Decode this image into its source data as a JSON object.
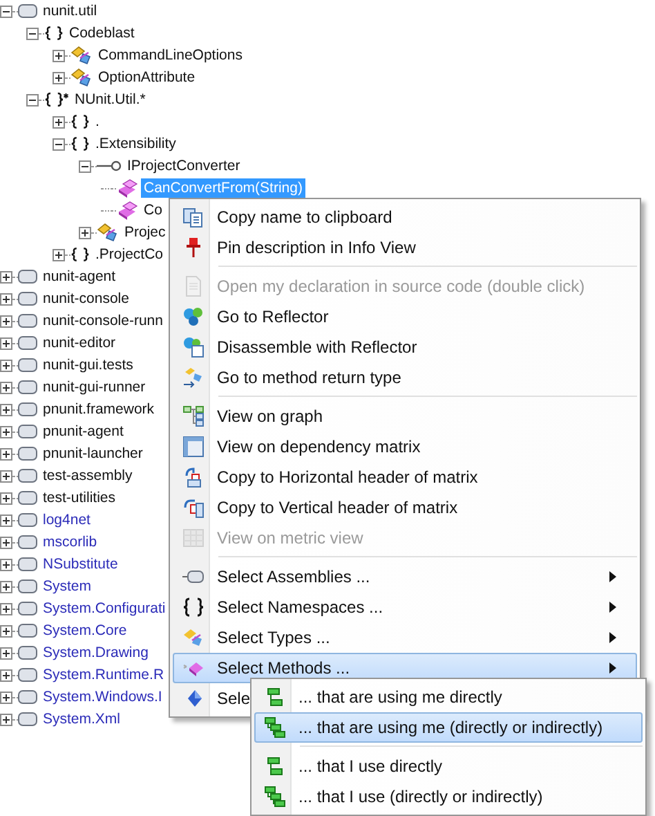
{
  "tree": [
    {
      "kind": "assembly",
      "label": "nunit.util",
      "external": false,
      "expanded": true,
      "selected": false,
      "children": [
        {
          "kind": "namespace",
          "label": "Codeblast",
          "expanded": true,
          "selected": false,
          "children": [
            {
              "kind": "class",
              "label": "CommandLineOptions",
              "expanded": false,
              "selected": false
            },
            {
              "kind": "class",
              "label": "OptionAttribute",
              "expanded": false,
              "selected": false
            }
          ]
        },
        {
          "kind": "namespace-group",
          "label": "NUnit.Util.*",
          "expanded": true,
          "selected": false,
          "children": [
            {
              "kind": "namespace",
              "label": ".",
              "expanded": false,
              "selected": false
            },
            {
              "kind": "namespace",
              "label": ".Extensibility",
              "expanded": true,
              "selected": false,
              "children": [
                {
                  "kind": "interface",
                  "label": "IProjectConverter",
                  "expanded": true,
                  "selected": false,
                  "children": [
                    {
                      "kind": "method",
                      "label": "CanConvertFrom(String)",
                      "selected": true
                    },
                    {
                      "kind": "method",
                      "label": "Co",
                      "selected": false
                    }
                  ]
                },
                {
                  "kind": "class",
                  "label": "Projec",
                  "expanded": false,
                  "selected": false
                }
              ]
            },
            {
              "kind": "namespace",
              "label": ".ProjectCo",
              "expanded": false,
              "selected": false
            }
          ]
        }
      ]
    },
    {
      "kind": "assembly",
      "label": "nunit-agent",
      "external": false,
      "expanded": false,
      "selected": false
    },
    {
      "kind": "assembly",
      "label": "nunit-console",
      "external": false,
      "expanded": false,
      "selected": false
    },
    {
      "kind": "assembly",
      "label": "nunit-console-runn",
      "external": false,
      "expanded": false,
      "selected": false
    },
    {
      "kind": "assembly",
      "label": "nunit-editor",
      "external": false,
      "expanded": false,
      "selected": false
    },
    {
      "kind": "assembly",
      "label": "nunit-gui.tests",
      "external": false,
      "expanded": false,
      "selected": false
    },
    {
      "kind": "assembly",
      "label": "nunit-gui-runner",
      "external": false,
      "expanded": false,
      "selected": false
    },
    {
      "kind": "assembly",
      "label": "pnunit.framework",
      "external": false,
      "expanded": false,
      "selected": false
    },
    {
      "kind": "assembly",
      "label": "pnunit-agent",
      "external": false,
      "expanded": false,
      "selected": false
    },
    {
      "kind": "assembly",
      "label": "pnunit-launcher",
      "external": false,
      "expanded": false,
      "selected": false
    },
    {
      "kind": "assembly",
      "label": "test-assembly",
      "external": false,
      "expanded": false,
      "selected": false
    },
    {
      "kind": "assembly",
      "label": "test-utilities",
      "external": false,
      "expanded": false,
      "selected": false
    },
    {
      "kind": "assembly",
      "label": "log4net",
      "external": true,
      "expanded": false,
      "selected": false
    },
    {
      "kind": "assembly",
      "label": "mscorlib",
      "external": true,
      "expanded": false,
      "selected": false
    },
    {
      "kind": "assembly",
      "label": "NSubstitute",
      "external": true,
      "expanded": false,
      "selected": false
    },
    {
      "kind": "assembly",
      "label": "System",
      "external": true,
      "expanded": false,
      "selected": false
    },
    {
      "kind": "assembly",
      "label": "System.Configurati",
      "external": true,
      "expanded": false,
      "selected": false
    },
    {
      "kind": "assembly",
      "label": "System.Core",
      "external": true,
      "expanded": false,
      "selected": false
    },
    {
      "kind": "assembly",
      "label": "System.Drawing",
      "external": true,
      "expanded": false,
      "selected": false
    },
    {
      "kind": "assembly",
      "label": "System.Runtime.R",
      "external": true,
      "expanded": false,
      "selected": false
    },
    {
      "kind": "assembly",
      "label": "System.Windows.I",
      "external": true,
      "expanded": false,
      "selected": false
    },
    {
      "kind": "assembly",
      "label": "System.Xml",
      "external": true,
      "expanded": false,
      "selected": false
    }
  ],
  "context_menu": {
    "items": [
      {
        "kind": "item",
        "label": "Copy name to clipboard",
        "disabled": false,
        "submenu": false,
        "selected": false
      },
      {
        "kind": "item",
        "label": "Pin description in Info View",
        "disabled": false,
        "submenu": false,
        "selected": false
      },
      {
        "kind": "separator"
      },
      {
        "kind": "item",
        "label": "Open my declaration in source code (double click)",
        "disabled": true,
        "submenu": false,
        "selected": false
      },
      {
        "kind": "item",
        "label": "Go to Reflector",
        "disabled": false,
        "submenu": false,
        "selected": false
      },
      {
        "kind": "item",
        "label": "Disassemble with Reflector",
        "disabled": false,
        "submenu": false,
        "selected": false
      },
      {
        "kind": "item",
        "label": "Go to method return type",
        "disabled": false,
        "submenu": false,
        "selected": false
      },
      {
        "kind": "separator"
      },
      {
        "kind": "item",
        "label": "View on graph",
        "disabled": false,
        "submenu": false,
        "selected": false
      },
      {
        "kind": "item",
        "label": "View on dependency matrix",
        "disabled": false,
        "submenu": false,
        "selected": false
      },
      {
        "kind": "item",
        "label": "Copy to Horizontal header of matrix",
        "disabled": false,
        "submenu": false,
        "selected": false
      },
      {
        "kind": "item",
        "label": "Copy to Vertical header of matrix",
        "disabled": false,
        "submenu": false,
        "selected": false
      },
      {
        "kind": "item",
        "label": "View on metric view",
        "disabled": true,
        "submenu": false,
        "selected": false
      },
      {
        "kind": "separator"
      },
      {
        "kind": "item",
        "label": "Select Assemblies ...",
        "disabled": false,
        "submenu": true,
        "selected": false
      },
      {
        "kind": "item",
        "label": "Select Namespaces ...",
        "disabled": false,
        "submenu": true,
        "selected": false
      },
      {
        "kind": "item",
        "label": "Select Types ...",
        "disabled": false,
        "submenu": true,
        "selected": false
      },
      {
        "kind": "item",
        "label": "Select Methods ...",
        "disabled": false,
        "submenu": true,
        "selected": true
      },
      {
        "kind": "item",
        "label": "Sele",
        "disabled": false,
        "selected": false
      }
    ]
  },
  "submenu": {
    "items": [
      {
        "kind": "item",
        "label": "... that are using me directly",
        "selected": false
      },
      {
        "kind": "item",
        "label": "... that are using me (directly or indirectly)",
        "selected": true
      },
      {
        "kind": "separator"
      },
      {
        "kind": "item",
        "label": "... that I use directly",
        "selected": false
      },
      {
        "kind": "item",
        "label": "... that I use (directly or indirectly)",
        "selected": false
      }
    ]
  }
}
